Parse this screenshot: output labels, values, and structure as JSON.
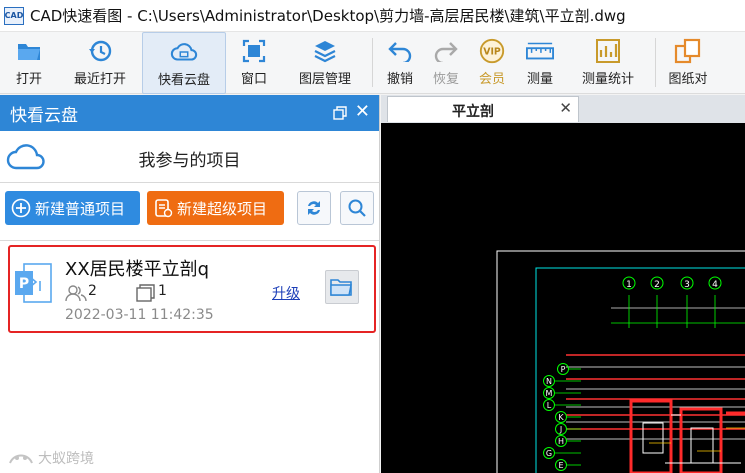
{
  "window": {
    "app_icon_text": "CAD",
    "title": "CAD快速看图 - C:\\Users\\Administrator\\Desktop\\剪力墙-高层居民楼\\建筑\\平立剖.dwg"
  },
  "toolbar": {
    "open": "打开",
    "recent": "最近打开",
    "cloud": "快看云盘",
    "window": "窗口",
    "layers": "图层管理",
    "undo": "撤销",
    "redo": "恢复",
    "vip": "会员",
    "measure": "测量",
    "measure_stats": "测量统计",
    "compare": "图纸对"
  },
  "panel": {
    "title": "快看云盘",
    "section_title": "我参与的项目",
    "new_normal": "新建普通项目",
    "new_super": "新建超级项目"
  },
  "project": {
    "name": "XX居民楼平立剖q",
    "members": "2",
    "files": "1",
    "upgrade": "升级",
    "time": "2022-03-11 11:42:35"
  },
  "document": {
    "tab_label": "平立剖",
    "grid_top": [
      "1",
      "2",
      "3",
      "4"
    ],
    "grid_left": [
      "P",
      "N",
      "M",
      "L",
      "K",
      "J",
      "H",
      "G",
      "E"
    ]
  },
  "watermark": "大蚁跨境",
  "colors": {
    "accent": "#2e86d6",
    "super_button": "#ef6c12",
    "highlight_border": "#e52424"
  }
}
